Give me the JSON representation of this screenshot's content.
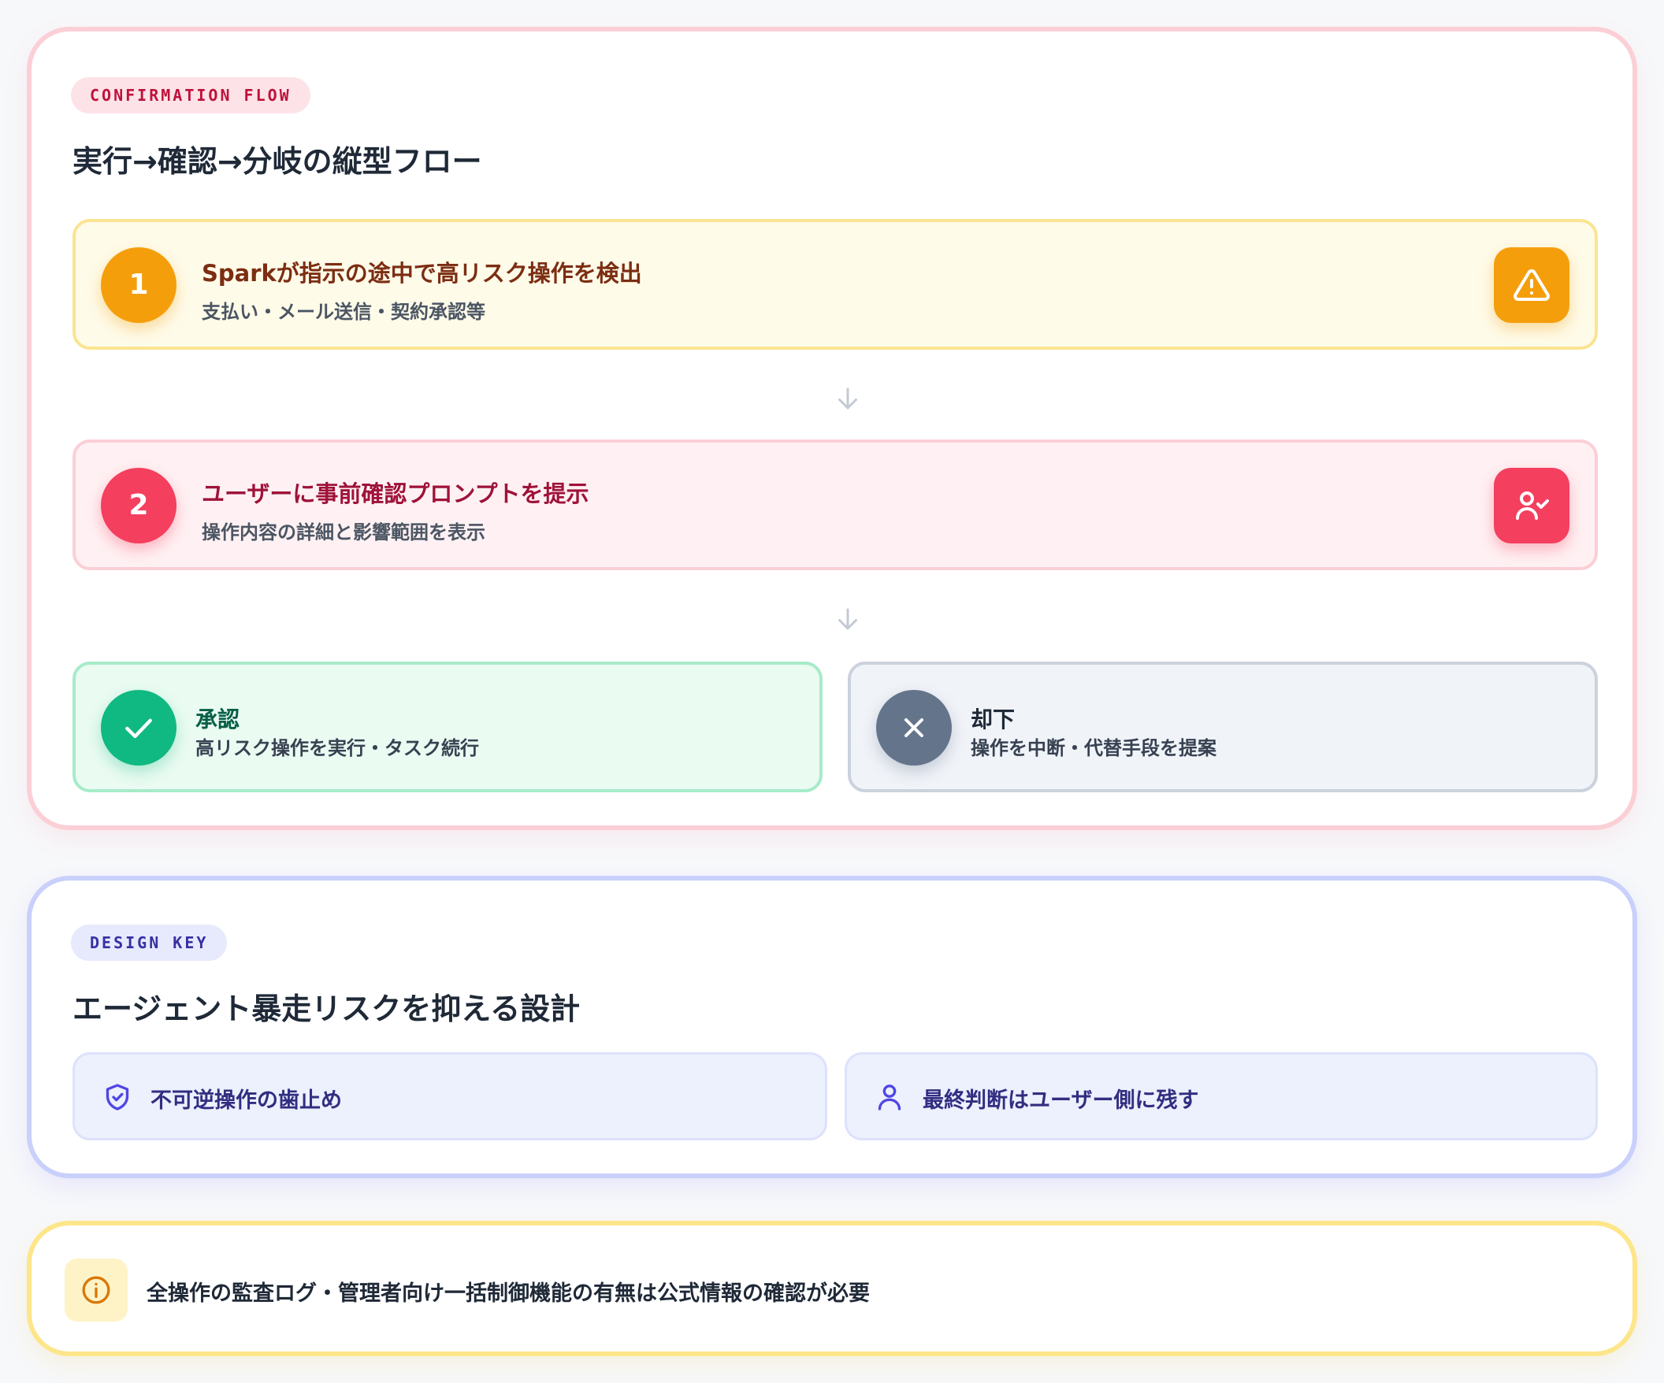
{
  "flow": {
    "tag": "CONFIRMATION FLOW",
    "heading": "実行→確認→分岐の縦型フロー",
    "steps": [
      {
        "number": "1",
        "title": "Sparkが指示の途中で高リスク操作を検出",
        "subtitle": "支払い・メール送信・契約承認等",
        "icon": "warning-icon",
        "color": "#f59e0b"
      },
      {
        "number": "2",
        "title": "ユーザーに事前確認プロンプトを提示",
        "subtitle": "操作内容の詳細と影響範囲を表示",
        "icon": "user-check-icon",
        "color": "#f43f5e"
      }
    ],
    "branches": [
      {
        "title": "承認",
        "subtitle": "高リスク操作を実行・タスク続行",
        "icon": "check-icon",
        "color": "#10b981"
      },
      {
        "title": "却下",
        "subtitle": "操作を中断・代替手段を提案",
        "icon": "x-icon",
        "color": "#64748b"
      }
    ]
  },
  "design_key": {
    "tag": "DESIGN KEY",
    "heading": "エージェント暴走リスクを抑える設計",
    "items": [
      {
        "label": "不可逆操作の歯止め",
        "icon": "shield-check-icon"
      },
      {
        "label": "最終判断はユーザー側に残す",
        "icon": "user-icon"
      }
    ]
  },
  "note": {
    "icon": "info-icon",
    "text": "全操作の監査ログ・管理者向け一括制御機能の有無は公式情報の確認が必要"
  }
}
